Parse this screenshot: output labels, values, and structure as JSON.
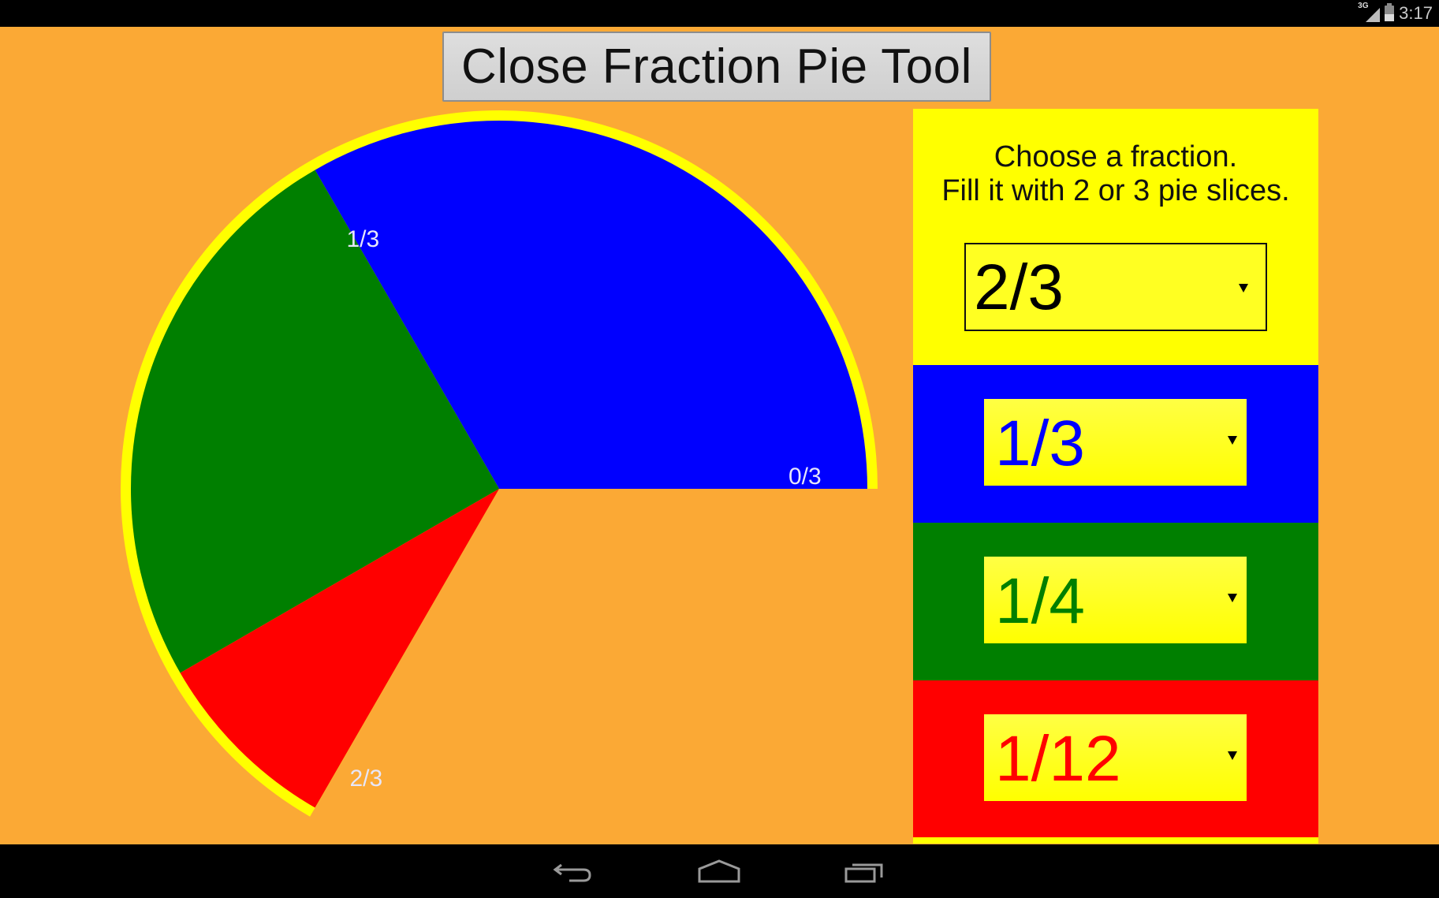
{
  "status_bar": {
    "network": "3G",
    "signal_icon": "signal-icon",
    "battery_icon": "battery-charging-icon",
    "time": "3:17"
  },
  "close_button": {
    "label": "Close Fraction Pie Tool"
  },
  "colors": {
    "background": "#FBA935",
    "highlight": "#FFFF00",
    "blue": "#0000FF",
    "green": "#007F00",
    "red": "#FF0000",
    "label_text": "#E6E6FA"
  },
  "panel": {
    "instruction_line1": "Choose a fraction.",
    "instruction_line2": "Fill it with 2 or 3 pie slices.",
    "target_fraction": {
      "selected": "2/3",
      "numerator": 2,
      "denominator": 3
    },
    "slices": [
      {
        "color": "blue",
        "selected": "1/3",
        "numerator": 1,
        "denominator": 3
      },
      {
        "color": "green",
        "selected": "1/4",
        "numerator": 1,
        "denominator": 4
      },
      {
        "color": "red",
        "selected": "1/12",
        "numerator": 1,
        "denominator": 12
      }
    ]
  },
  "pie": {
    "target_arc": {
      "from": 0,
      "to": 0.6667
    },
    "boundary_labels": [
      "0/3",
      "1/3",
      "2/3"
    ]
  },
  "nav_bar": {
    "back_icon": "back-icon",
    "home_icon": "home-icon",
    "recents_icon": "recents-icon"
  }
}
